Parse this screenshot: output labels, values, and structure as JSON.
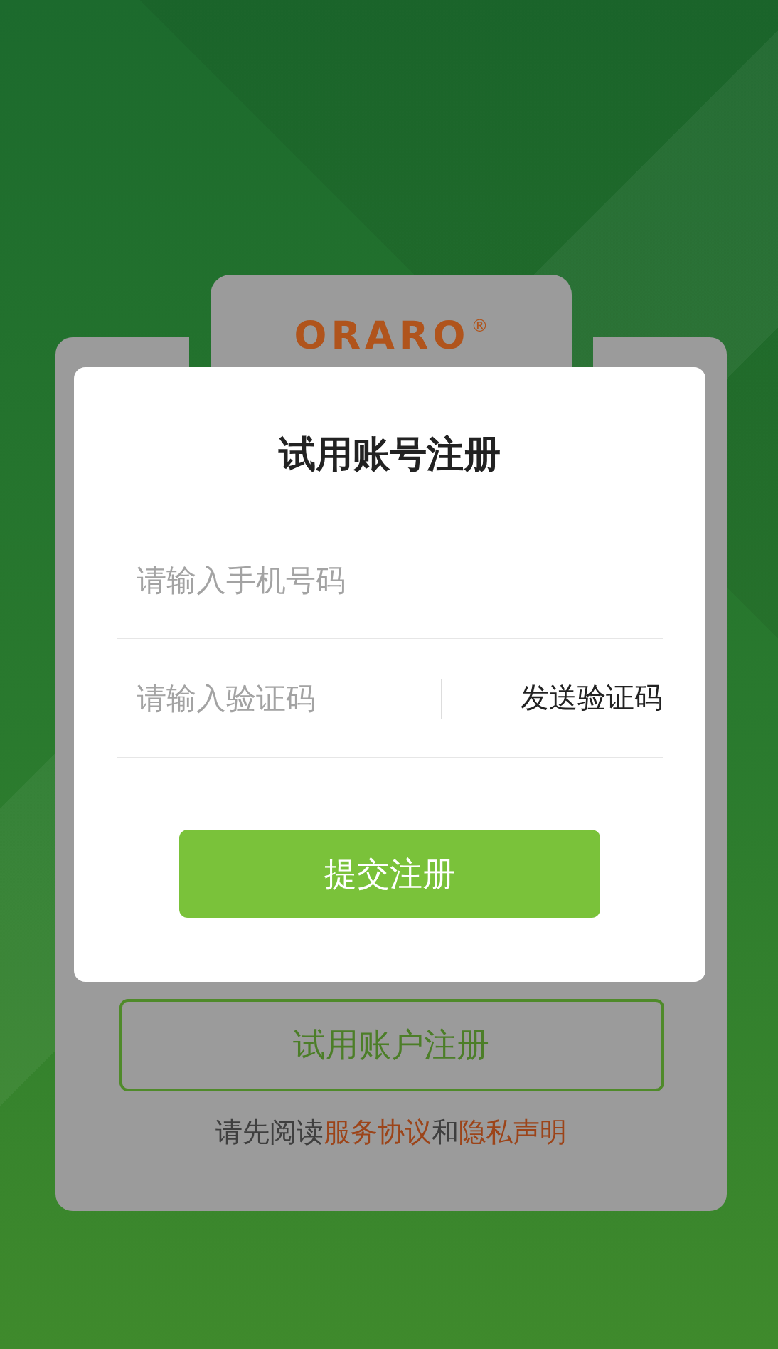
{
  "logo": {
    "text": "ORARO",
    "mark": "®"
  },
  "background_card": {
    "primary_button": "试用账户注册",
    "agreement": {
      "prefix": "请先阅读",
      "link_1": "服务协议",
      "joiner": "和",
      "link_2": "隐私声明"
    }
  },
  "dialog": {
    "title": "试用账号注册",
    "phone_field": {
      "placeholder": "请输入手机号码"
    },
    "code_field": {
      "placeholder": "请输入验证码"
    },
    "send_code_button": "发送验证码",
    "submit_button": "提交注册"
  }
}
